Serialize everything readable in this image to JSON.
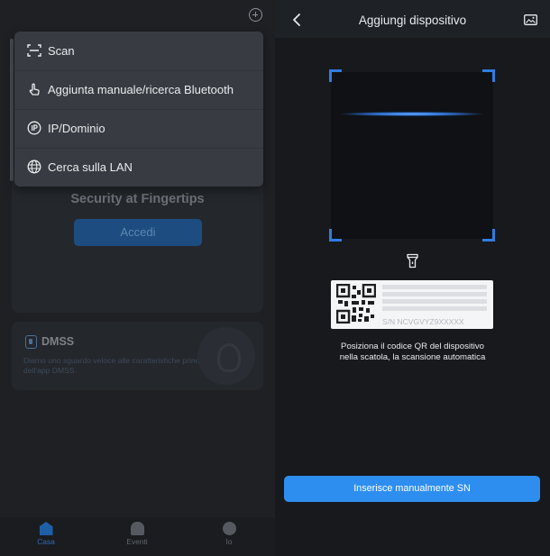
{
  "left_panel": {
    "menu": {
      "items": [
        {
          "label": "Scan",
          "icon": "scan-icon"
        },
        {
          "label": "Aggiunta manuale/ricerca Bluetooth",
          "icon": "tap-hand-icon"
        },
        {
          "label": "IP/Dominio",
          "icon": "ip-icon"
        },
        {
          "label": "Cerca sulla LAN",
          "icon": "globe-icon"
        }
      ]
    },
    "tagline": "Security at Fingertips",
    "login_button": "Accedi",
    "dmss_card": {
      "title": "DMSS",
      "description": "Diamo uno sguardo veloce alle caratteristiche principali dell'app DMSS."
    },
    "tabbar": [
      {
        "label": "Casa",
        "icon": "home-icon",
        "active": true
      },
      {
        "label": "Eventi",
        "icon": "bell-icon",
        "active": false
      },
      {
        "label": "Io",
        "icon": "user-icon",
        "active": false
      }
    ]
  },
  "right_panel": {
    "title": "Aggiungi dispositivo",
    "label_sn": "S/N  NCVGVYZ9XXXXX",
    "instruction_line1": "Posiziona il codice QR del dispositivo",
    "instruction_line2": "nella scatola, la scansione automatica",
    "manual_button": "Inserisce manualmente SN"
  },
  "colors": {
    "accent": "#2e8ef0",
    "scan_corner": "#2f7de0",
    "menu_bg": "#383c42"
  }
}
